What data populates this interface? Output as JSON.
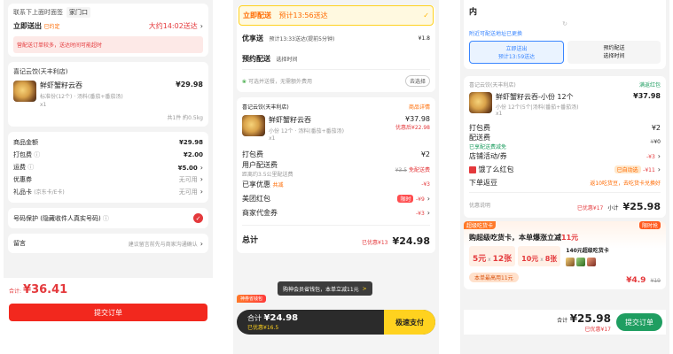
{
  "panel1": {
    "contact_row": {
      "left": "联系下上面时面签",
      "badge": "家门口"
    },
    "delivery": {
      "label": "立即送出",
      "sub": "已约定",
      "time": "大约14:02送达"
    },
    "notice": "营配送订单较多，送达时间可能超时",
    "store": "喜记云饺(天丰利店)",
    "item": {
      "name": "鲜虾蟹籽云吞",
      "spec": "标准份(12个) · 汤料(番茄+番茄汤)",
      "qty": "x1",
      "price": "¥29.98"
    },
    "summary": "共1件 約0.5kg",
    "fees": [
      {
        "label": "商品金额",
        "value": "¥29.98"
      },
      {
        "label": "打包费",
        "value": "¥2.00"
      },
      {
        "label": "运费",
        "value": "¥5.00"
      },
      {
        "label": "优惠券",
        "value": "无可用"
      },
      {
        "label": "礼品卡",
        "value": "无可用",
        "sub": "(京东卡/E卡)"
      }
    ],
    "privacy": "号码保护 (隐藏收件人真实号码)",
    "remark": {
      "label": "留言",
      "value": "建议留言前先与商家沟通确认"
    },
    "total_label": "合计:",
    "total_value": "¥36.41",
    "submit": "提交订单"
  },
  "panel2": {
    "tab_active": {
      "label": "立即配送",
      "time": "预计13:56送达"
    },
    "fast": {
      "label": "优享送",
      "time": "预计13:33送达(提前5分钟)",
      "price": "¥1.8"
    },
    "reserve": {
      "label": "预约配送",
      "value": "选择时间"
    },
    "eco_notice": "可选并送餐，无需额外费用",
    "eco_btn": "去选择",
    "store": "喜记云饺(天丰利店)",
    "store_tag": "商品详情",
    "item": {
      "name": "鲜虾蟹籽云吞",
      "spec": "小份 12个 · 汤料(番茄+番茄汤)",
      "qty": "x1",
      "price": "¥37.98",
      "discount": "优惠后¥22.98"
    },
    "fees": [
      {
        "label": "打包费",
        "value": "¥2"
      },
      {
        "label": "用户配送费",
        "sub": "距离约3.5公里配送费",
        "old": "¥3.5",
        "value": "免配送费"
      },
      {
        "label": "已享优惠",
        "sub": "共减",
        "value": "-¥3"
      },
      {
        "label": "美团红包",
        "tag": "限时",
        "value": "-¥9"
      },
      {
        "label": "商家代金券",
        "value": "-¥3"
      }
    ],
    "total_label": "总计",
    "total_small": "已优惠¥13",
    "total_value": "¥24.98",
    "toast": "购神会员省钱包，本单立减11元",
    "toast_btn": ">",
    "promo_tag": "神券省钱包",
    "bottom": {
      "label": "合计",
      "value": "¥24.98",
      "saved": "已优惠¥16.5",
      "pay": "极速支付"
    }
  },
  "panel3": {
    "top": "内",
    "top_hint": "附近可配送地址已更换",
    "opt1": {
      "title": "立即送出",
      "sub": "预计13:59送达"
    },
    "opt2": {
      "title": "预约配送",
      "sub": "选择时间"
    },
    "store": "喜记云饺(天丰利店)",
    "store_badge": "满返红包",
    "item": {
      "name": "鲜虾蟹籽云吞-小份 12个",
      "spec": "小份 12个(5个|汤料(番茄+番茄汤)",
      "qty": "x1",
      "price": "¥37.98"
    },
    "fees": [
      {
        "label": "打包费",
        "value": "¥2"
      },
      {
        "label": "配送费",
        "sub": "已享配送费减免",
        "value": "¥0"
      },
      {
        "label": "店铺活动/券",
        "value": "-¥3"
      },
      {
        "label": "饿了么红包",
        "tag": "已自动选",
        "value": "-¥11"
      },
      {
        "label": "下单返豆",
        "value": "返10吃货豆，去吃货卡兑换好"
      }
    ],
    "summary": {
      "left": "优惠说明",
      "saved": "已优惠¥17",
      "sub_label": "小计",
      "value": "¥25.98"
    },
    "promo": {
      "tag": "超级吃货卡",
      "headline": "购超级吃货卡，本单爆涨立减",
      "amount": "11元",
      "badge": "限时抢",
      "card_title": "140元超级吃货卡",
      "coupons": [
        {
          "v": "5元",
          "x": "12张"
        },
        {
          "v": "10元",
          "x": "8张"
        }
      ],
      "btn": "本单最高用11元",
      "price": "¥4.9",
      "old": "¥19"
    },
    "bottom": {
      "label": "合计",
      "value": "¥25.98",
      "saved": "已优惠¥17",
      "submit": "提交订单"
    }
  },
  "colors": {
    "red": "#e4393c",
    "orange": "#ff6a00",
    "green": "#1f9e61",
    "blue": "#3a86ff",
    "dark": "#222222",
    "yellow": "#ffd21f"
  }
}
